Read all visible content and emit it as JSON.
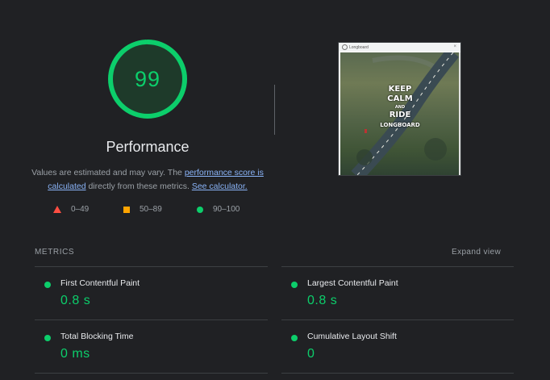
{
  "colors": {
    "pass": "#0cce6b",
    "average": "#ffa400",
    "fail": "#ff4e42",
    "background": "#202124",
    "link": "#8ab4f8"
  },
  "score": {
    "value": 99,
    "fraction": 0.99
  },
  "title": "Performance",
  "description": {
    "text1": "Values are estimated and may vary. The ",
    "link1": "performance score is calculated",
    "text2": " directly from these metrics. ",
    "link2": "See calculator."
  },
  "legend": [
    {
      "icon": "triangle-icon",
      "label": "0–49"
    },
    {
      "icon": "square-icon",
      "label": "50–89"
    },
    {
      "icon": "circle-icon",
      "label": "90–100"
    }
  ],
  "screenshot": {
    "tab_title": "Longboard",
    "line1": "KEEP",
    "line2": "CALM",
    "line3": "AND",
    "line4": "RIDE",
    "line5": "LONGBOARD"
  },
  "metrics_section": {
    "label": "METRICS",
    "expand_label": "Expand view",
    "items": [
      {
        "name": "First Contentful Paint",
        "value": "0.8 s",
        "icon": "circle-icon"
      },
      {
        "name": "Largest Contentful Paint",
        "value": "0.8 s",
        "icon": "circle-icon"
      },
      {
        "name": "Total Blocking Time",
        "value": "0 ms",
        "icon": "circle-icon"
      },
      {
        "name": "Cumulative Layout Shift",
        "value": "0",
        "icon": "circle-icon"
      }
    ]
  }
}
